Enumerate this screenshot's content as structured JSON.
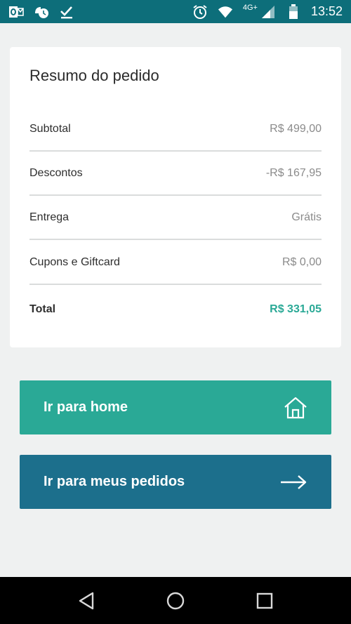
{
  "status_bar": {
    "network_label": "4G+",
    "time": "13:52"
  },
  "summary": {
    "title": "Resumo do pedido",
    "rows": [
      {
        "label": "Subtotal",
        "value": "R$ 499,00"
      },
      {
        "label": "Descontos",
        "value": "-R$ 167,95"
      },
      {
        "label": "Entrega",
        "value": "Grátis"
      },
      {
        "label": "Cupons e Giftcard",
        "value": "R$ 0,00"
      }
    ],
    "total": {
      "label": "Total",
      "value": "R$ 331,05"
    }
  },
  "actions": {
    "home_label": "Ir para home",
    "orders_label": "Ir para meus pedidos"
  },
  "icons": {
    "home": "home-icon",
    "arrow": "arrow-right-icon"
  },
  "colors": {
    "status_bar": "#0d6e7a",
    "accent_green": "#2aa996",
    "accent_blue": "#1c6f8c",
    "background": "#eff1f1"
  }
}
